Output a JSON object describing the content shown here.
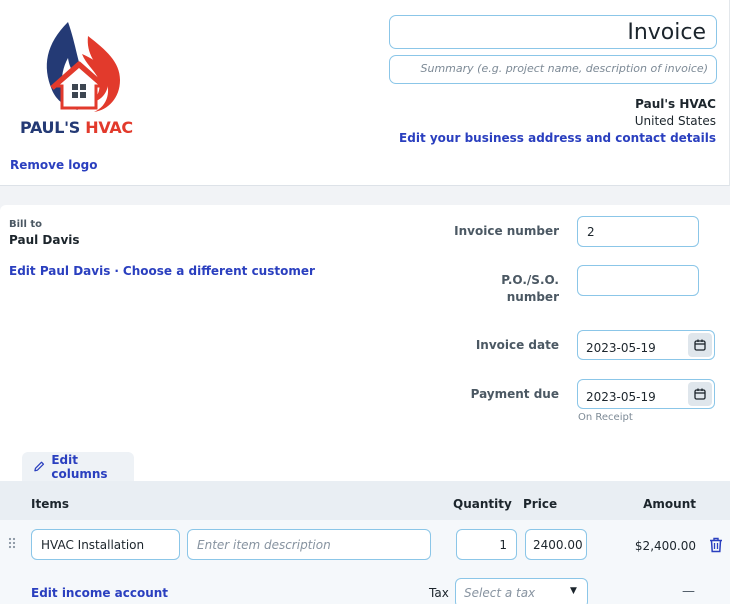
{
  "header": {
    "logo_text_a": "PAUL'S ",
    "logo_text_b": "HVAC",
    "remove_logo": "Remove logo",
    "invoice_title": "Invoice",
    "summary_placeholder": "Summary (e.g. project name, description of invoice)",
    "business_name": "Paul's HVAC",
    "business_country": "United States",
    "edit_business": "Edit your business address and contact details"
  },
  "bill": {
    "label": "Bill to",
    "customer": "Paul Davis",
    "edit_customer": "Edit Paul Davis",
    "separator": "·",
    "choose_customer": "Choose a different customer"
  },
  "fields": {
    "invoice_number_label": "Invoice number",
    "invoice_number": "2",
    "po_label_line1": "P.O./S.O.",
    "po_label_line2": "number",
    "po_value": "",
    "invoice_date_label": "Invoice date",
    "invoice_date": "2023-05-19",
    "payment_due_label": "Payment due",
    "payment_due": "2023-05-19",
    "payment_terms": "On Receipt"
  },
  "table": {
    "edit_columns": "Edit columns",
    "headers": {
      "items": "Items",
      "quantity": "Quantity",
      "price": "Price",
      "amount": "Amount"
    },
    "rows": [
      {
        "item": "HVAC Installation",
        "description_placeholder": "Enter item description",
        "quantity": "1",
        "price": "2400.00",
        "amount": "$2,400.00"
      }
    ],
    "edit_income_account": "Edit income account",
    "tax_label": "Tax",
    "tax_placeholder": "Select a tax",
    "tax_amount": "—"
  },
  "colors": {
    "link": "#2a3fbf",
    "input_border": "#8bc6e8",
    "logo_red": "#e23a2c",
    "logo_blue": "#243a75"
  }
}
